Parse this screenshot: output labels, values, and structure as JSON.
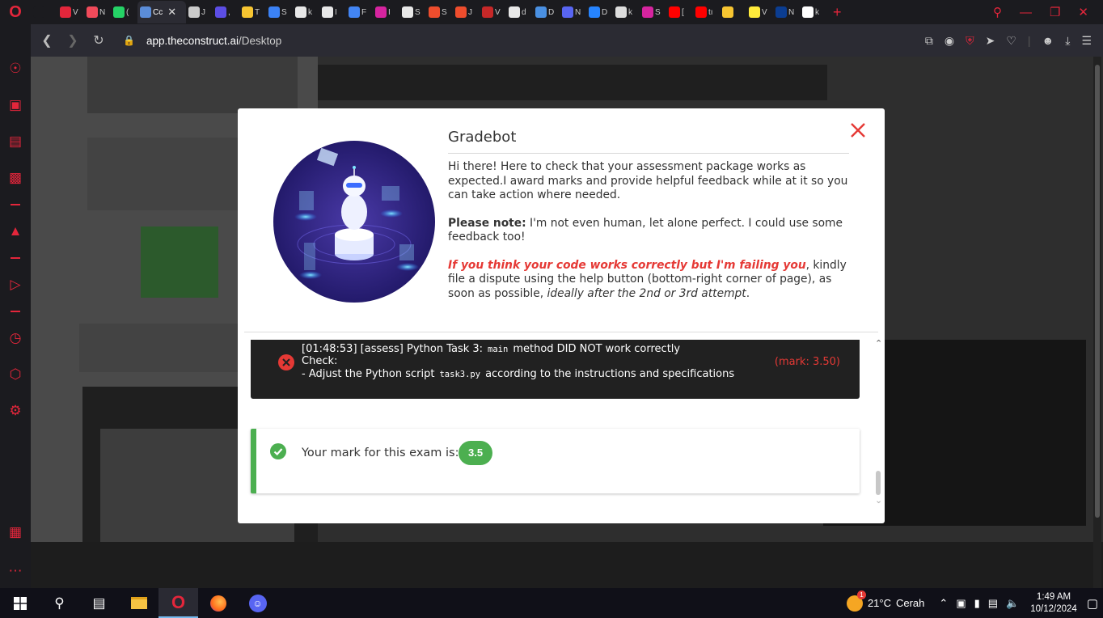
{
  "browser": {
    "tabs": [
      {
        "label": "",
        "fav_color": "#1b1b1f",
        "icon": "game-icon"
      },
      {
        "label": "V",
        "fav_color": "#e3263b",
        "icon": "opera-icon"
      },
      {
        "label": "N",
        "fav_color": "#f04a5a",
        "icon": "app-icon"
      },
      {
        "label": "(",
        "fav_color": "#25d366",
        "icon": "whatsapp-icon"
      },
      {
        "label": "Cc",
        "fav_color": "#5b8dd9",
        "icon": "construct-icon",
        "active": true
      },
      {
        "label": "J",
        "fav_color": "#cccccc",
        "icon": "chatgpt-icon"
      },
      {
        "label": ",",
        "fav_color": "#5c4ee5",
        "icon": "list-icon"
      },
      {
        "label": "T",
        "fav_color": "#f7c531",
        "icon": "note-icon"
      },
      {
        "label": "S",
        "fav_color": "#3b82f6",
        "icon": "bookmark-icon"
      },
      {
        "label": "k",
        "fav_color": "#e8e8e8",
        "icon": "chatgpt-icon"
      },
      {
        "label": "I",
        "fav_color": "#e8e8e8",
        "icon": "chatgpt-icon"
      },
      {
        "label": "F",
        "fav_color": "#4285f4",
        "icon": "docs-icon"
      },
      {
        "label": "I",
        "fav_color": "#d6249f",
        "icon": "instagram-icon"
      },
      {
        "label": "S",
        "fav_color": "#e8e8e8",
        "icon": "chatgpt-icon"
      },
      {
        "label": "S",
        "fav_color": "#ee4d2d",
        "icon": "shopee-icon"
      },
      {
        "label": "J",
        "fav_color": "#ee4d2d",
        "icon": "shopee-icon"
      },
      {
        "label": "V",
        "fav_color": "#c62828",
        "icon": "video-icon"
      },
      {
        "label": "d",
        "fav_color": "#e8e8e8",
        "icon": "dicoding-icon"
      },
      {
        "label": "D",
        "fav_color": "#4a90e2",
        "icon": "heart-icon"
      },
      {
        "label": "N",
        "fav_color": "#5865f2",
        "icon": "m-icon"
      },
      {
        "label": "D",
        "fav_color": "#2684ff",
        "icon": "s-icon"
      },
      {
        "label": "k",
        "fav_color": "#dddddd",
        "icon": "page-icon"
      },
      {
        "label": "S",
        "fav_color": "#d6249f",
        "icon": "instagram-icon"
      },
      {
        "label": "[",
        "fav_color": "#ff0000",
        "icon": "youtube-icon"
      },
      {
        "label": "tı",
        "fav_color": "#ff0000",
        "icon": "youtube-icon"
      },
      {
        "label": "",
        "fav_color": "#f7c531",
        "icon": "note-icon"
      },
      {
        "label": "V",
        "fav_color": "#ffeb3b",
        "icon": "mail-icon"
      },
      {
        "label": "N",
        "fav_color": "#0b3d91",
        "icon": "nasa-icon"
      },
      {
        "label": "k",
        "fav_color": "#ffffff",
        "icon": "github-icon"
      }
    ],
    "url_host": "app.theconstruct.ai",
    "url_path": "/Desktop"
  },
  "modal": {
    "title": "Gradebot",
    "intro": "Hi there! Here to check that your assessment package works as expected.I award marks and provide helpful feedback while at it so you can take action where needed.",
    "note_label": "Please note:",
    "note_text": " I'm not even human, let alone perfect. I could use some feedback too!",
    "dispute_warn": "If you think your code works correctly but I'm failing you",
    "dispute_text": ", kindly file a dispute using the help button (bottom-right corner of page), as soon as possible, ",
    "dispute_ital": "ideally after the 2nd or 3rd attempt",
    "dispute_end": ".",
    "log": {
      "line1_pre": "[01:48:53] [assess] Python Task 3:",
      "line1_code": "main",
      "line1_post": "method DID NOT work correctly",
      "line2": "Check:",
      "line3_pre": "- Adjust the Python script",
      "line3_code": "task3.py",
      "line3_post": "according to the instructions and specifications",
      "mark": "(mark: 3.50)"
    },
    "result_text": "Your mark for this exam is:",
    "score": "3.5"
  },
  "taskbar": {
    "weather_temp": "21°C",
    "weather_text": "Cerah",
    "weather_badge": "1",
    "time": "1:49 AM",
    "date": "10/12/2024"
  },
  "colors": {
    "accent": "#e3263b",
    "error": "#e53935",
    "success": "#4caf50"
  }
}
